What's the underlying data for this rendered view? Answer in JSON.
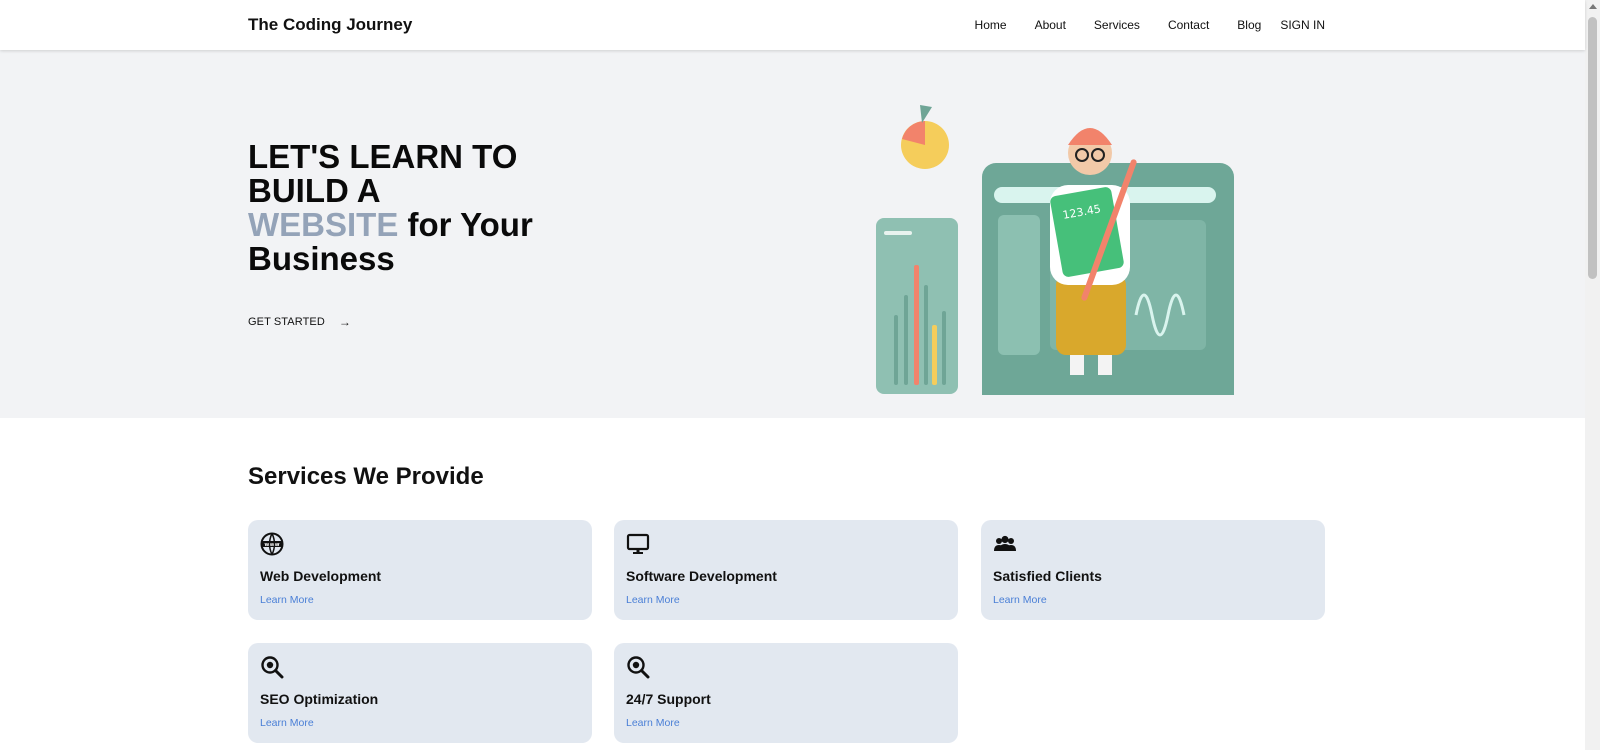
{
  "app": {
    "brand": "The Coding Journey"
  },
  "nav": {
    "items": [
      {
        "label": "Home"
      },
      {
        "label": "About"
      },
      {
        "label": "Services"
      },
      {
        "label": "Contact"
      },
      {
        "label": "Blog"
      }
    ],
    "signin": "SIGN IN"
  },
  "hero": {
    "line1": "LET'S LEARN TO",
    "line2": "BUILD A",
    "accent": "WEBSITE",
    "line3_rest": " for Your",
    "line4": "Business",
    "cta": "GET STARTED",
    "cta_icon": "arrow-right-icon"
  },
  "services": {
    "title": "Services We Provide",
    "cards": [
      {
        "title": "Web Development",
        "link": "Learn More",
        "icon": "www-globe-icon"
      },
      {
        "title": "Software Development",
        "link": "Learn More",
        "icon": "monitor-icon"
      },
      {
        "title": "Satisfied Clients",
        "link": "Learn More",
        "icon": "users-icon"
      },
      {
        "title": "SEO Optimization",
        "link": "Learn More",
        "icon": "search-icon"
      },
      {
        "title": "24/7 Support",
        "link": "Learn More",
        "icon": "search-icon"
      }
    ]
  },
  "colors": {
    "hero_bg": "#f2f3f5",
    "accent_text": "#94a3b8",
    "card_bg": "#e2e8f0",
    "link": "#4a7fd6"
  }
}
